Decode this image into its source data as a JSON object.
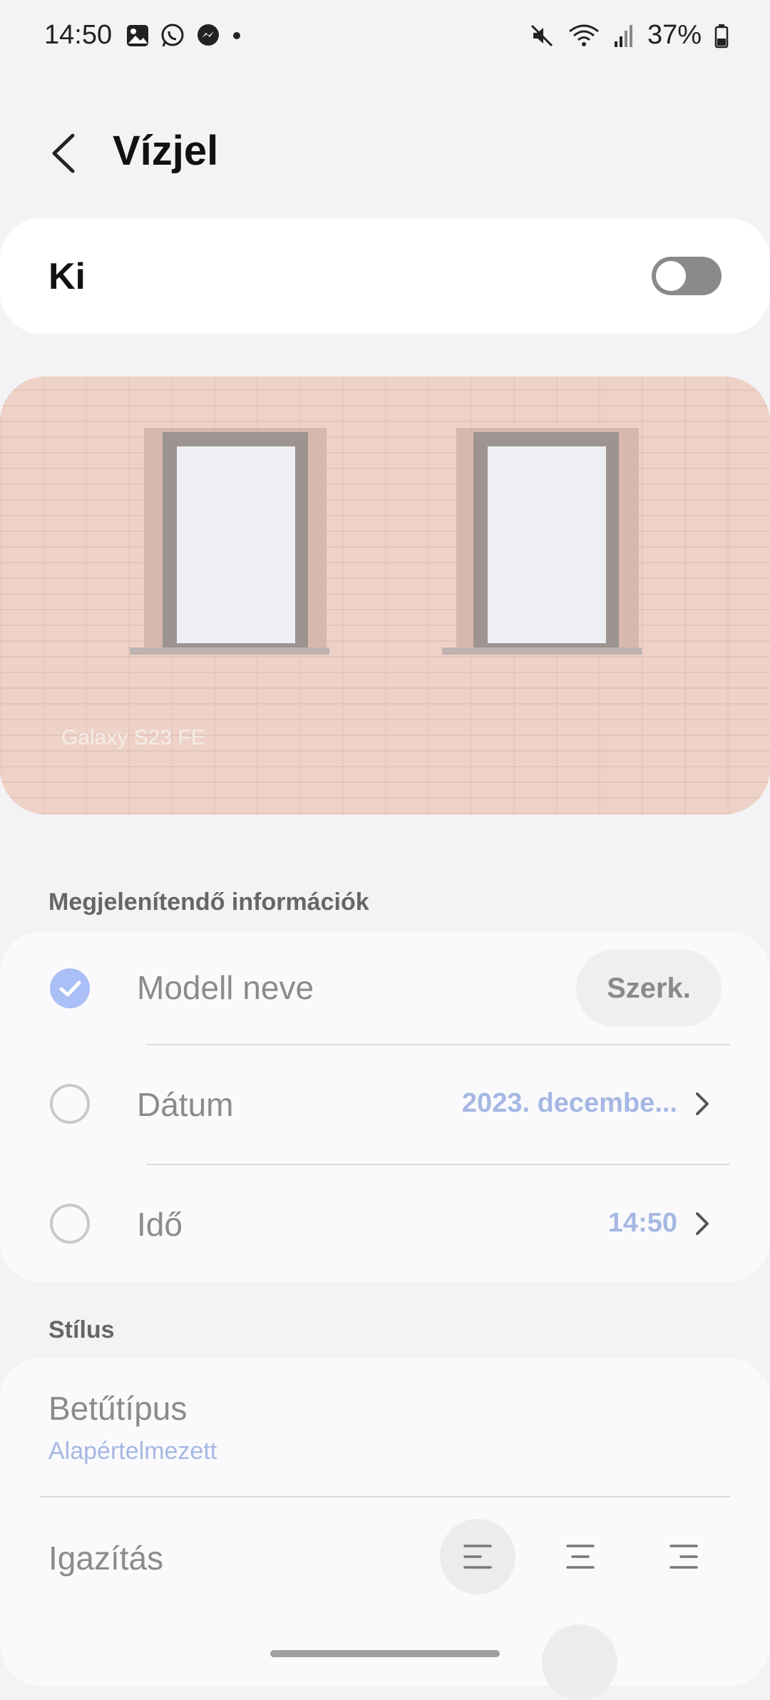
{
  "status_bar": {
    "time": "14:50",
    "battery": "37%",
    "left_icons": [
      "gallery-icon",
      "whatsapp-icon",
      "messenger-icon",
      "dot-icon"
    ],
    "right_icons": [
      "mute-icon",
      "wifi-icon",
      "signal-icon",
      "battery-icon"
    ]
  },
  "header": {
    "title": "Vízjel"
  },
  "main_toggle": {
    "label": "Ki",
    "state": "off"
  },
  "preview": {
    "watermark_text": "Galaxy S23 FE"
  },
  "info_section": {
    "header": "Megjelenítendő információk",
    "items": [
      {
        "label": "Modell neve",
        "checked": true,
        "action": "Szerk."
      },
      {
        "label": "Dátum",
        "checked": false,
        "value": "2023. decembe..."
      },
      {
        "label": "Idő",
        "checked": false,
        "value": "14:50"
      }
    ]
  },
  "style_section": {
    "header": "Stílus",
    "font_label": "Betűtípus",
    "font_value": "Alapértelmezett",
    "alignment_label": "Igazítás",
    "alignment_options": [
      "align-left-icon",
      "align-center-icon",
      "align-right-icon"
    ],
    "alignment_selected": "align-left-icon"
  },
  "colors": {
    "accent": "#a6b7e3",
    "check_on": "#a9bff5",
    "switch_off": "#8a8a8a",
    "background": "#f3f3f5"
  }
}
